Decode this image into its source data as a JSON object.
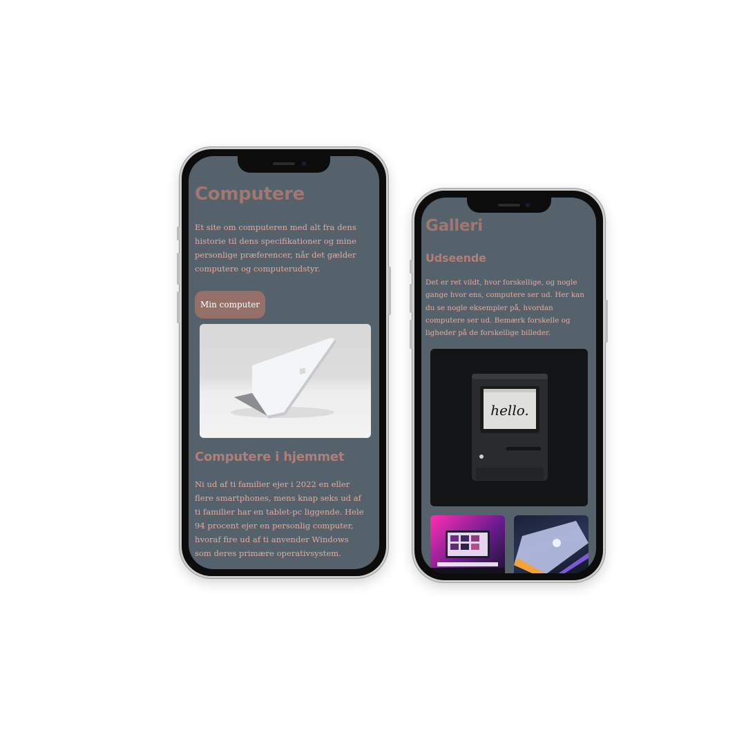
{
  "phone_home": {
    "title": "Computere",
    "intro": "Et site om computeren med alt fra dens historie til dens specifikationer og mine personlige præferencer, når det gælder computere og computerudstyr.",
    "cta_label": "Min computer",
    "section_heading": "Computere i hjemmet",
    "section_text": "Ni ud af ti familier ejer i 2022 en eller flere smartphones, mens knap seks ud af ti familier har en tablet-pc liggende. Hele 94 procent ejer en personlig computer, hvoraf fire ud af ti anvender Windows som deres primære operativsystem."
  },
  "phone_gallery": {
    "title": "Galleri",
    "subheading": "Udseende",
    "text": "Det er ret vildt, hvor forskellige, og nogle gange hvor ens, computere ser ud. Her kan du se nogle eksempler på, hvordan computere ser ud. Bemærk forskelle og ligheder på de forskellige billeder.",
    "hello_screen_text": "hello."
  },
  "colors": {
    "background": "#56626b",
    "heading": "#a07872",
    "body_text": "#e3aaa1",
    "button": "#957069"
  }
}
